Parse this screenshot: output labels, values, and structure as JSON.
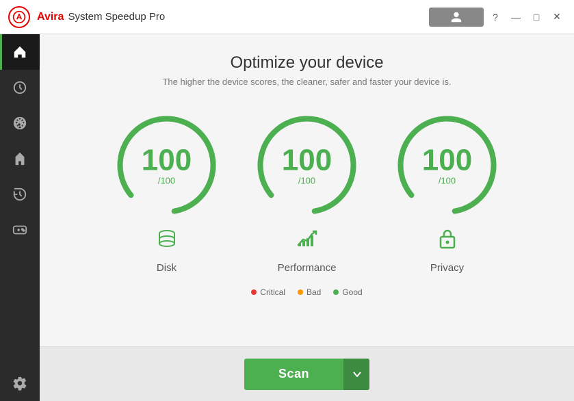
{
  "titlebar": {
    "brand": "Avira",
    "product": "System Speedup Pro",
    "user_btn_label": "",
    "question_btn": "?",
    "minimize_btn": "—",
    "maximize_btn": "□",
    "close_btn": "✕"
  },
  "page": {
    "title": "Optimize your device",
    "subtitle": "The higher the device scores, the cleaner, safer and faster your device is."
  },
  "gauges": [
    {
      "id": "disk",
      "value": "100",
      "max": "/100",
      "label": "Disk",
      "icon": "disk-icon"
    },
    {
      "id": "performance",
      "value": "100",
      "max": "/100",
      "label": "Performance",
      "icon": "performance-icon"
    },
    {
      "id": "privacy",
      "value": "100",
      "max": "/100",
      "label": "Privacy",
      "icon": "lock-icon"
    }
  ],
  "legend": [
    {
      "color": "#e53935",
      "label": "Critical"
    },
    {
      "color": "#ff9800",
      "label": "Bad"
    },
    {
      "color": "#4caf50",
      "label": "Good"
    }
  ],
  "scan_button": {
    "label": "Scan",
    "dropdown_arrow": "❯"
  },
  "sidebar": {
    "items": [
      {
        "id": "home",
        "icon": "home-icon",
        "active": true
      },
      {
        "id": "clock",
        "icon": "clock-icon",
        "active": false
      },
      {
        "id": "optimizer",
        "icon": "optimizer-icon",
        "active": false
      },
      {
        "id": "cleaner",
        "icon": "cleaner-icon",
        "active": false
      },
      {
        "id": "history",
        "icon": "history-icon",
        "active": false
      },
      {
        "id": "games",
        "icon": "games-icon",
        "active": false
      },
      {
        "id": "settings",
        "icon": "settings-icon",
        "active": false
      }
    ]
  }
}
